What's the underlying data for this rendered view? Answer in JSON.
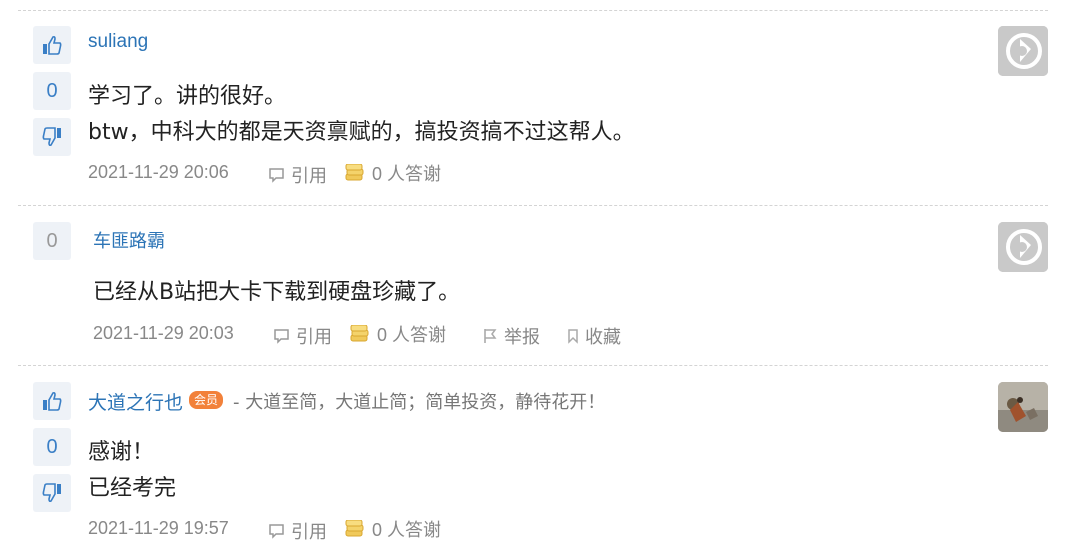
{
  "posts": [
    {
      "username": "suliang",
      "vote_count": "0",
      "lines": [
        "学习了。讲的很好。",
        "btw，中科大的都是天资禀赋的，搞投资搞不过这帮人。"
      ],
      "timestamp": "2021-11-29 20:06",
      "quote_label": "引用",
      "thanks_label": "0 人答谢"
    },
    {
      "username": "车匪路霸",
      "vote_count": "0",
      "lines": [
        "已经从B站把大卡下载到硬盘珍藏了。"
      ],
      "timestamp": "2021-11-29 20:03",
      "quote_label": "引用",
      "thanks_label": "0 人答谢",
      "report_label": "举报",
      "favorite_label": "收藏"
    },
    {
      "username": "大道之行也",
      "member_badge": "会员",
      "signature": "- 大道至简，大道止简；简单投资，静待花开！",
      "vote_count": "0",
      "lines": [
        "感谢！",
        "已经考完"
      ],
      "timestamp": "2021-11-29 19:57",
      "quote_label": "引用",
      "thanks_label": "0 人答谢"
    }
  ],
  "colors": {
    "link_blue": "#2c74b6",
    "vote_bg": "#eef2f7",
    "meta_gray": "#888888",
    "badge_orange": "#f2813a"
  },
  "icons": {
    "upvote": "thumbs-up-icon",
    "downvote": "thumbs-down-icon",
    "quote": "speech-bubble-icon",
    "thanks": "coins-icon",
    "report": "flag-icon",
    "favorite": "bookmark-icon",
    "avatar_default": "default-avatar-icon"
  }
}
